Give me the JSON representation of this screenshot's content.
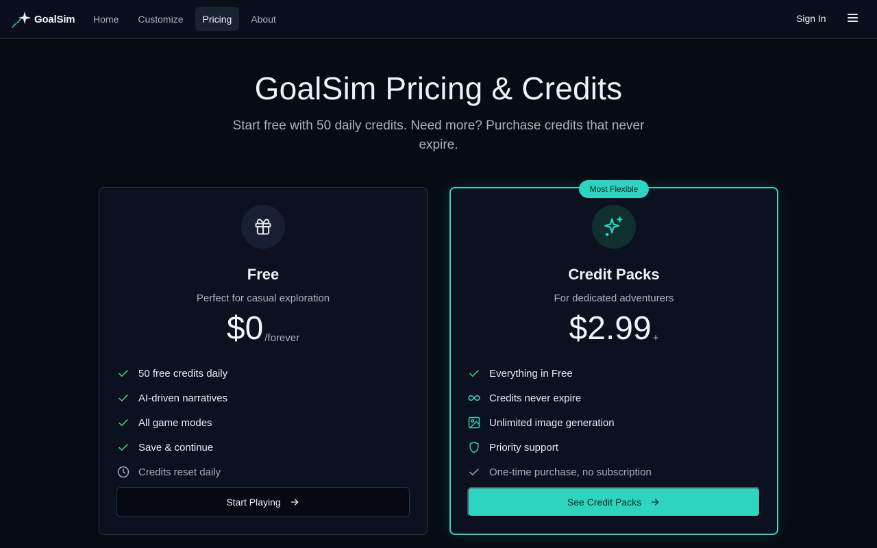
{
  "nav": {
    "logo_text": "GoalSim",
    "links": [
      {
        "label": "Home",
        "active": false
      },
      {
        "label": "Customize",
        "active": false
      },
      {
        "label": "Pricing",
        "active": true
      },
      {
        "label": "About",
        "active": false
      }
    ],
    "signin": "Sign In",
    "menu_icon": "hamburger-menu-icon"
  },
  "hero": {
    "title": "GoalSim Pricing & Credits",
    "subtitle": "Start free with 50 daily credits. Need more? Purchase credits that never expire."
  },
  "plans": {
    "free": {
      "icon": "gift-icon",
      "name": "Free",
      "desc": "Perfect for casual exploration",
      "price": "$0",
      "price_suffix": "/forever",
      "features": [
        {
          "icon": "check-icon",
          "text": "50 free credits daily",
          "muted": false
        },
        {
          "icon": "check-icon",
          "text": "AI-driven narratives",
          "muted": false
        },
        {
          "icon": "check-icon",
          "text": "All game modes",
          "muted": false
        },
        {
          "icon": "check-icon",
          "text": "Save & continue",
          "muted": false
        },
        {
          "icon": "clock-icon",
          "text": "Credits reset daily",
          "muted": true
        }
      ],
      "cta": "Start Playing"
    },
    "pack": {
      "badge": "Most Flexible",
      "icon": "sparkles-icon",
      "name": "Credit Packs",
      "desc": "For dedicated adventurers",
      "price": "$2.99",
      "price_suffix": "+",
      "features": [
        {
          "icon": "check-icon",
          "text": "Everything in Free",
          "muted": false
        },
        {
          "icon": "infinity-icon",
          "text": "Credits never expire",
          "muted": false
        },
        {
          "icon": "image-icon",
          "text": "Unlimited image generation",
          "muted": false
        },
        {
          "icon": "shield-icon",
          "text": "Priority support",
          "muted": false
        },
        {
          "icon": "check-icon",
          "text": "One-time purchase, no subscription",
          "muted": true
        }
      ],
      "cta": "See Credit Packs"
    }
  },
  "colors": {
    "accent": "#2dd4bf",
    "check_green": "#4ade80",
    "background": "#070b14"
  }
}
